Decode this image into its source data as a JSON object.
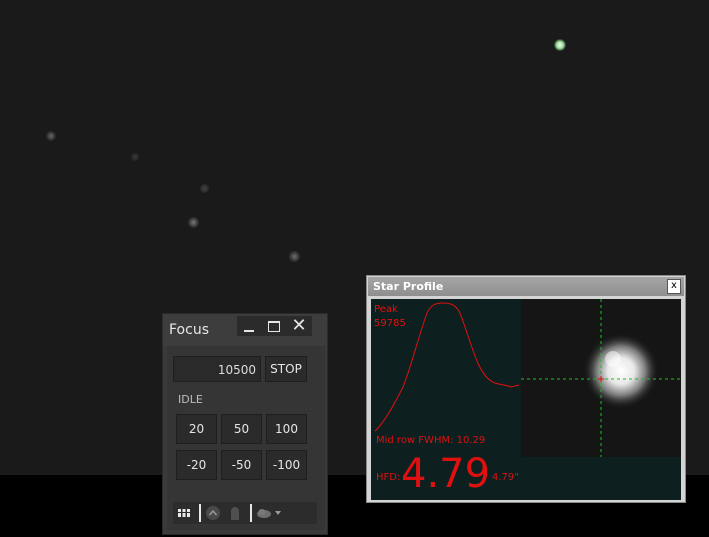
{
  "focus_panel": {
    "title": "Focus",
    "position": "10500",
    "stop_label": "STOP",
    "status": "IDLE",
    "step_buttons": [
      "20",
      "50",
      "100",
      "-20",
      "-50",
      "-100"
    ]
  },
  "star_profile": {
    "title": "Star Profile",
    "close_label": "x",
    "peak_label": "Peak",
    "peak_value": "59785",
    "fwhm_text": "Mid row FWHM: 10.29",
    "hfd_label": "HFD:",
    "hfd_value": "4.79",
    "hfd_arcsec": "4.79\""
  },
  "colors": {
    "sky": "#1a1a1a",
    "profile_red": "#e01010",
    "crosshair_green": "#19c419"
  }
}
